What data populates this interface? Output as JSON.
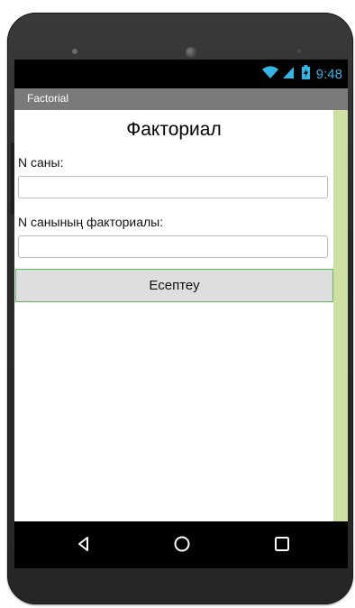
{
  "status_bar": {
    "wifi_icon": "wifi-icon",
    "signal_icon": "signal-icon",
    "battery_icon": "battery-charging-icon",
    "time": "9:48",
    "icon_color": "#33b5e5"
  },
  "title_bar": {
    "title": "Factorial",
    "background": "#7a7a7a"
  },
  "main": {
    "heading": "Факториал",
    "n_label": "N саны:",
    "n_input_value": "",
    "result_label": "N санының факториалы:",
    "result_input_value": "",
    "calc_button_label": "Есептеу",
    "side_bar_color": "#cfe0a4",
    "button_border_color": "#5cb85c"
  },
  "nav_bar": {
    "back_icon": "back-triangle-icon",
    "home_icon": "home-circle-icon",
    "recents_icon": "recents-square-icon"
  }
}
